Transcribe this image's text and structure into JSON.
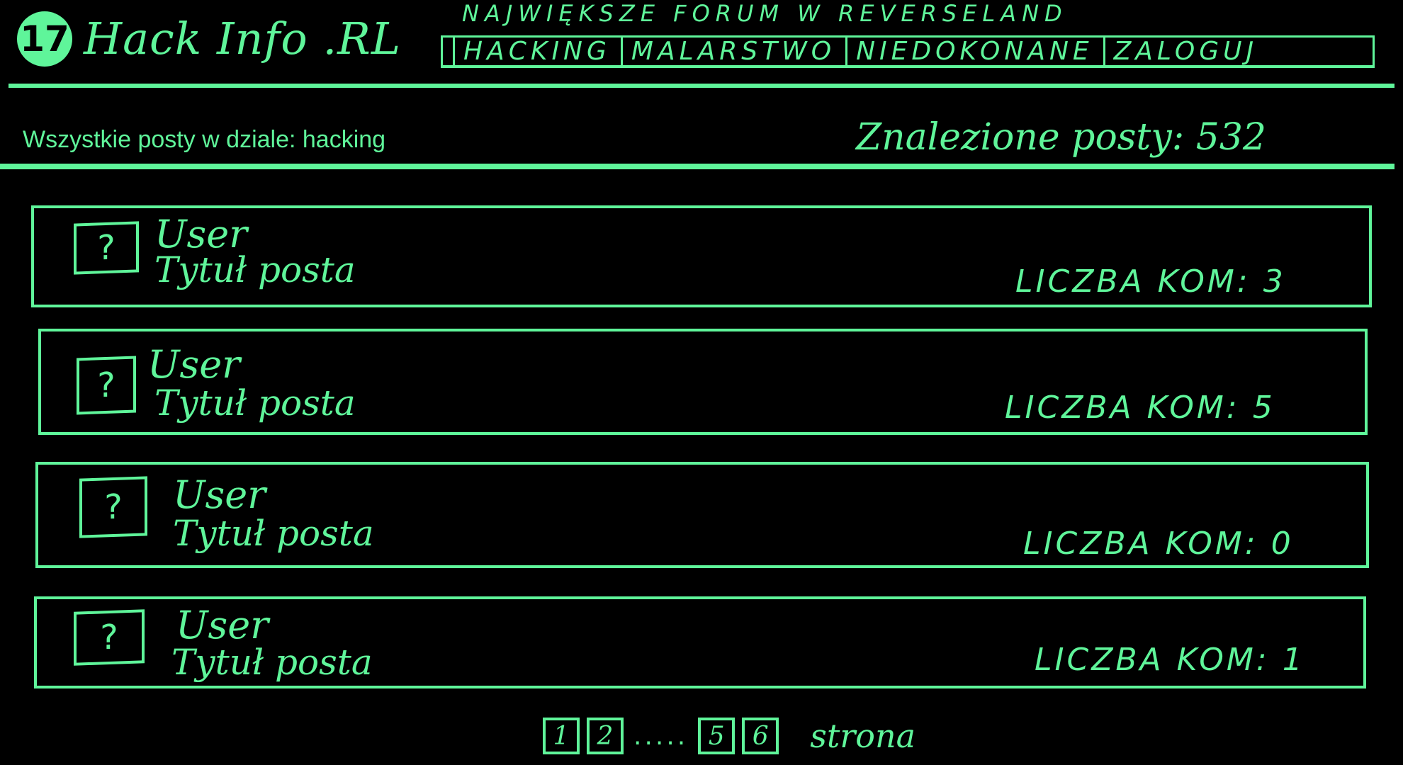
{
  "header": {
    "logo_badge": "17",
    "logo_text": "Hack Info .RL",
    "tagline": "NAJWIĘKSZE FORUM W REVERSELAND"
  },
  "nav": {
    "items": [
      {
        "label": "HACKING"
      },
      {
        "label": "MALARSTWO"
      },
      {
        "label": "NIEDOKONANE"
      },
      {
        "label": "ZALOGUJ"
      }
    ]
  },
  "section": {
    "title": "Wszystkie posty w dziale: hacking",
    "found_label": "Znalezione posty: 532"
  },
  "posts": [
    {
      "avatar": "?",
      "user": "User",
      "title": "Tytuł posta",
      "comments": "LICZBA KOM: 3"
    },
    {
      "avatar": "?",
      "user": "User",
      "title": "Tytuł posta",
      "comments": "LICZBA KOM: 5"
    },
    {
      "avatar": "?",
      "user": "User",
      "title": "Tytuł posta",
      "comments": "LICZBA KOM: 0"
    },
    {
      "avatar": "?",
      "user": "User",
      "title": "Tytuł posta",
      "comments": "LICZBA KOM: 1"
    }
  ],
  "pagination": {
    "pages_start": [
      "1",
      "2"
    ],
    "ellipsis": ".....",
    "pages_end": [
      "5",
      "6"
    ],
    "label": "strona"
  },
  "colors": {
    "accent": "#5ff59a",
    "background": "#000000"
  }
}
